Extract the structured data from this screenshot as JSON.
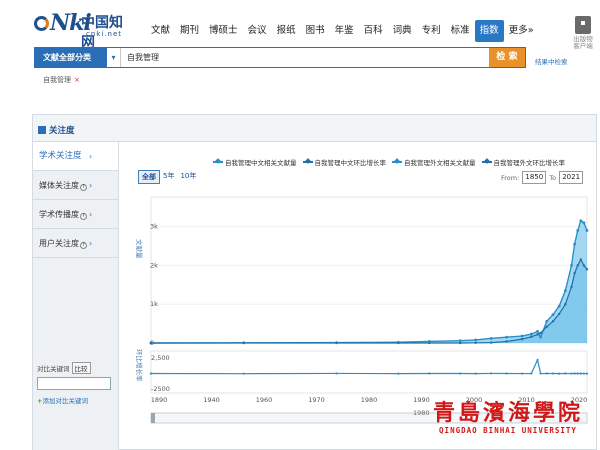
{
  "header": {
    "logo": {
      "mark": "Nki",
      "cn": "中国知网",
      "domain": "cnki.net"
    },
    "nav": [
      {
        "label": "文献",
        "active": false
      },
      {
        "label": "期刊",
        "active": false
      },
      {
        "label": "博硕士",
        "active": false
      },
      {
        "label": "会议",
        "active": false
      },
      {
        "label": "报纸",
        "active": false
      },
      {
        "label": "图书",
        "active": false
      },
      {
        "label": "年鉴",
        "active": false
      },
      {
        "label": "百科",
        "active": false
      },
      {
        "label": "词典",
        "active": false
      },
      {
        "label": "专利",
        "active": false
      },
      {
        "label": "标准",
        "active": false
      },
      {
        "label": "指数",
        "active": true
      },
      {
        "label": "更多»",
        "active": false
      }
    ],
    "download_label": "出版物\n客户端"
  },
  "search": {
    "category": "文献全部分类",
    "query": "自我管理",
    "submit": "检 索",
    "in_results": "结果中检索"
  },
  "filter_tag": {
    "label": "自我管理",
    "remove": "×"
  },
  "panel": {
    "title": "关注度",
    "sidebar": [
      {
        "label": "学术关注度",
        "active": true
      },
      {
        "label": "媒体关注度",
        "active": false
      },
      {
        "label": "学术传播度",
        "active": false
      },
      {
        "label": "用户关注度",
        "active": false
      }
    ],
    "compare": {
      "label": "对比关键词",
      "button": "比较",
      "add": "添加对比关键词"
    },
    "ranges": [
      "全部",
      "5年",
      "10年"
    ],
    "date_from_label": "From:",
    "date_from": "1850",
    "date_to_label": "To",
    "date_to": "2021"
  },
  "chart_data": {
    "type": "line",
    "legend": [
      "自我管理中文相关文献量",
      "自我管理中文环比增长率",
      "自我管理外文相关文献量",
      "自我管理外文环比增长率"
    ],
    "upper_axis": {
      "ylabel": "文献量",
      "ticks": [
        "0",
        "1k",
        "2k",
        "3k"
      ],
      "ylim": [
        0,
        3300
      ]
    },
    "lower_axis": {
      "ylabel": "环比增长率",
      "ticks": [
        "2,500",
        "-2500"
      ],
      "ylim": [
        -2500,
        3000
      ]
    },
    "x_ticks": [
      "1890",
      "1940",
      "1960",
      "1970",
      "1980",
      "1990",
      "2000",
      "2010",
      "2020"
    ],
    "navigator_label": "1980",
    "years": [
      1850,
      1880,
      1910,
      1940,
      1960,
      1970,
      1980,
      1985,
      1990,
      1995,
      2000,
      2003,
      2005,
      2006,
      2008,
      2010,
      2012,
      2014,
      2016,
      2017,
      2018,
      2019,
      2020,
      2021
    ],
    "series": [
      {
        "name": "自我管理中文相关文献量",
        "values": [
          0,
          0,
          5,
          10,
          20,
          40,
          60,
          80,
          120,
          150,
          180,
          230,
          300,
          150,
          560,
          730,
          950,
          1350,
          2000,
          2550,
          2900,
          3150,
          3100,
          2900
        ]
      },
      {
        "name": "自我管理外文相关文献量",
        "values": [
          0,
          0,
          0,
          0,
          0,
          0,
          0,
          5,
          10,
          40,
          100,
          160,
          220,
          260,
          420,
          560,
          750,
          1000,
          1450,
          1800,
          2000,
          2150,
          2000,
          1900
        ]
      },
      {
        "name": "自我管理中文环比增长率",
        "values": [
          0,
          10,
          -20,
          15,
          -10,
          5,
          10,
          -15,
          20,
          5,
          -5,
          10,
          2200,
          0,
          10,
          5,
          -10,
          5,
          0,
          5,
          10,
          5,
          0,
          -5
        ]
      }
    ],
    "colors": {
      "primary": "#2a8fc8",
      "secondary": "#1f6fa8",
      "area": "#59b8e8"
    }
  },
  "watermark": {
    "cn": "青島濱海學院",
    "en": "QINGDAO BINHAI UNIVERSITY"
  },
  "colors": {
    "brand": "#1f4f8f",
    "accent": "#2a6eb8",
    "search_button": "#e8902a",
    "watermark": "#d01818"
  }
}
